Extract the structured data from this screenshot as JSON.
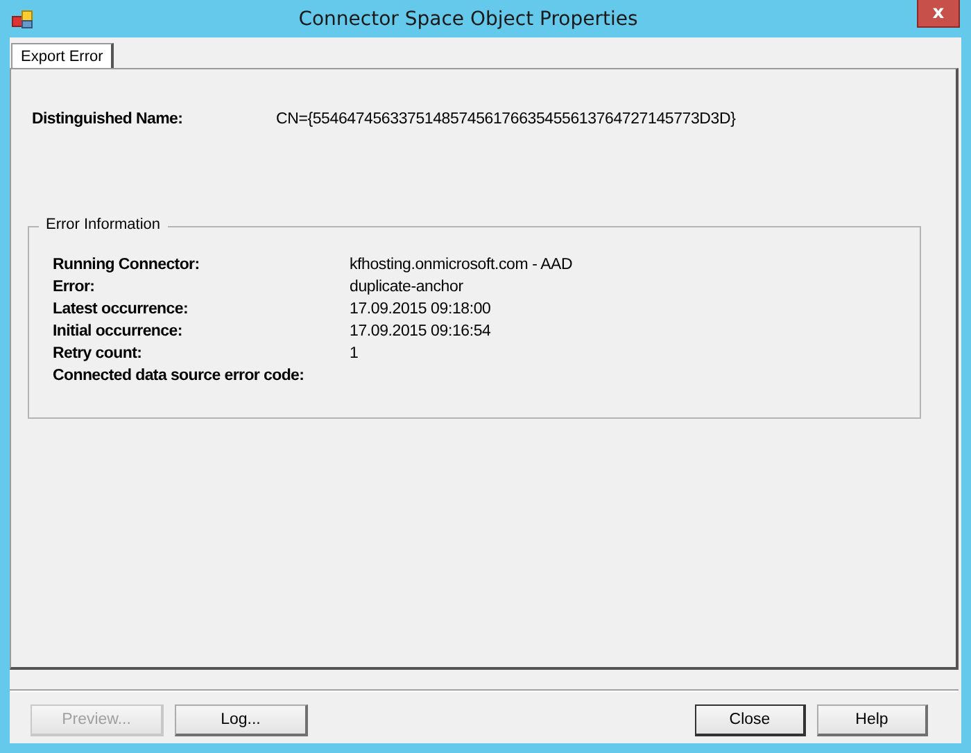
{
  "window": {
    "title": "Connector Space Object Properties",
    "close": "x"
  },
  "tabs": [
    {
      "label": "Export Error",
      "selected": true
    }
  ],
  "distinguished_name": {
    "label": "Distinguished Name:",
    "value": "CN={554647456337514857456176635455613764727145773D3D}"
  },
  "error_information": {
    "title": "Error Information",
    "rows": [
      {
        "label": "Running Connector:",
        "value": "kfhosting.onmicrosoft.com - AAD"
      },
      {
        "label": "Error:",
        "value": "duplicate-anchor"
      },
      {
        "label": "Latest occurrence:",
        "value": "17.09.2015 09:18:00"
      },
      {
        "label": "Initial occurrence:",
        "value": "17.09.2015 09:16:54"
      },
      {
        "label": "Retry count:",
        "value": "1"
      },
      {
        "label": "Connected data source error code:"
      }
    ]
  },
  "buttons_left": [
    {
      "label": "Preview...",
      "disabled": true,
      "default": false
    },
    {
      "label": "Log...",
      "disabled": false,
      "default": false
    }
  ],
  "buttons_right": [
    {
      "label": "Close",
      "disabled": false,
      "default": true
    },
    {
      "label": "Help",
      "disabled": false,
      "default": false
    }
  ]
}
